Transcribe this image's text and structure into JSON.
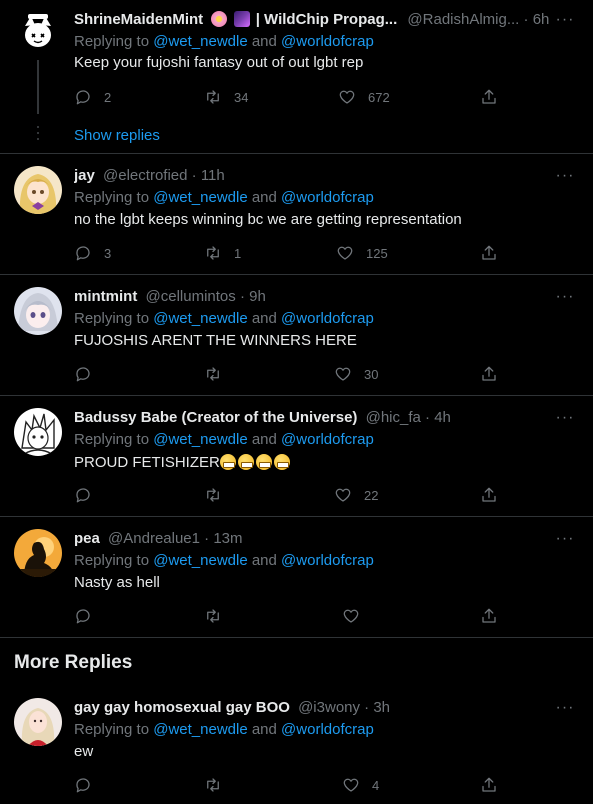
{
  "tweets": [
    {
      "name": "ShrineMaidenMint",
      "name_suffix": " | WildChip Propag...",
      "handle": "@RadishAlmig...",
      "time": "6h",
      "replying_prefix": "Replying to",
      "mention1": "@wet_newdle",
      "and": "and",
      "mention2": "@worldofcrap",
      "text": "Keep your fujoshi fantasy out of out lgbt rep",
      "replies": "2",
      "retweets": "34",
      "likes": "672",
      "show_replies": "Show replies"
    },
    {
      "name": "jay",
      "handle": "@electrofied",
      "time": "11h",
      "replying_prefix": "Replying to",
      "mention1": "@wet_newdle",
      "and": "and",
      "mention2": "@worldofcrap",
      "text": "no the lgbt keeps winning bc we are getting representation",
      "replies": "3",
      "retweets": "1",
      "likes": "125"
    },
    {
      "name": "mintmint",
      "handle": "@cellumintos",
      "time": "9h",
      "replying_prefix": "Replying to",
      "mention1": "@wet_newdle",
      "and": "and",
      "mention2": "@worldofcrap",
      "text": "FUJOSHIS ARENT THE WINNERS HERE",
      "replies": "",
      "retweets": "",
      "likes": "30"
    },
    {
      "name": "Badussy Babe (Creator of the Universe)",
      "handle": "@hic_fa",
      "time": "4h",
      "replying_prefix": "Replying to",
      "mention1": "@wet_newdle",
      "and": "and",
      "mention2": "@worldofcrap",
      "text": "PROUD FETISHIZER",
      "replies": "",
      "retweets": "",
      "likes": "22"
    },
    {
      "name": "pea",
      "handle": "@Andrealue1",
      "time": "13m",
      "replying_prefix": "Replying to",
      "mention1": "@wet_newdle",
      "and": "and",
      "mention2": "@worldofcrap",
      "text": "Nasty as hell",
      "replies": "",
      "retweets": "",
      "likes": ""
    },
    {
      "name": "gay gay homosexual gay BOO",
      "handle": "@i3wony",
      "time": "3h",
      "replying_prefix": "Replying to",
      "mention1": "@wet_newdle",
      "and": "and",
      "mention2": "@worldofcrap",
      "text": "ew",
      "replies": "",
      "retweets": "",
      "likes": "4"
    }
  ],
  "more_replies_title": "More Replies",
  "dot_sep": "·",
  "more_glyph": "···",
  "colors": {
    "accent": "#1d9bf0",
    "muted": "#71767b",
    "text": "#e7e9ea",
    "border": "#2f3336"
  }
}
